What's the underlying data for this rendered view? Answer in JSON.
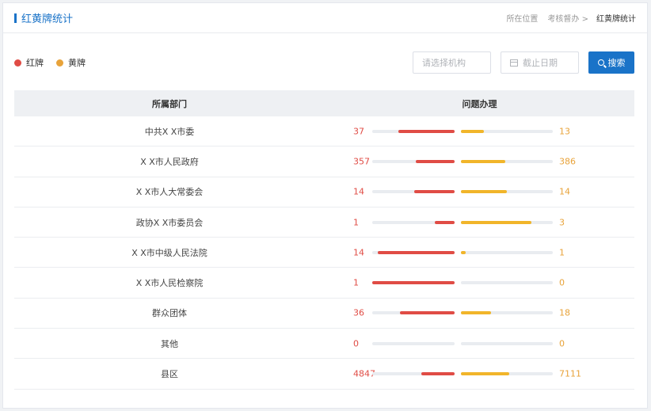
{
  "header": {
    "title": "红黄牌统计",
    "breadcrumb": [
      "所在位置",
      "考核督办 >",
      "红黄牌统计"
    ]
  },
  "legend": [
    {
      "label": "红牌",
      "color": "#e04c45"
    },
    {
      "label": "黄牌",
      "color": "#e8a33a"
    }
  ],
  "filters": {
    "org_placeholder": "请选择机构",
    "date_placeholder": "截止日期",
    "search_label": "搜索"
  },
  "table": {
    "columns": [
      "所属部门",
      "问题办理"
    ],
    "rows": [
      {
        "dept": "中共X X市委",
        "red": 37,
        "yellow": 13,
        "red_fill": 0.68,
        "yellow_fill": 0.25
      },
      {
        "dept": "X X市人民政府",
        "red": 357,
        "yellow": 386,
        "red_fill": 0.47,
        "yellow_fill": 0.48
      },
      {
        "dept": "X X市人大常委会",
        "red": 14,
        "yellow": 14,
        "red_fill": 0.49,
        "yellow_fill": 0.5
      },
      {
        "dept": "政协X X市委员会",
        "red": 1,
        "yellow": 3,
        "red_fill": 0.24,
        "yellow_fill": 0.77
      },
      {
        "dept": "X X市中级人民法院",
        "red": 14,
        "yellow": 1,
        "red_fill": 0.93,
        "yellow_fill": 0.05
      },
      {
        "dept": "X X市人民检察院",
        "red": 1,
        "yellow": 0,
        "red_fill": 1.0,
        "yellow_fill": 0.0
      },
      {
        "dept": "群众团体",
        "red": 36,
        "yellow": 18,
        "red_fill": 0.66,
        "yellow_fill": 0.33
      },
      {
        "dept": "其他",
        "red": 0,
        "yellow": 0,
        "red_fill": 0.0,
        "yellow_fill": 0.0
      },
      {
        "dept": "县区",
        "red": 4847,
        "yellow": 7111,
        "red_fill": 0.4,
        "yellow_fill": 0.53
      }
    ]
  }
}
